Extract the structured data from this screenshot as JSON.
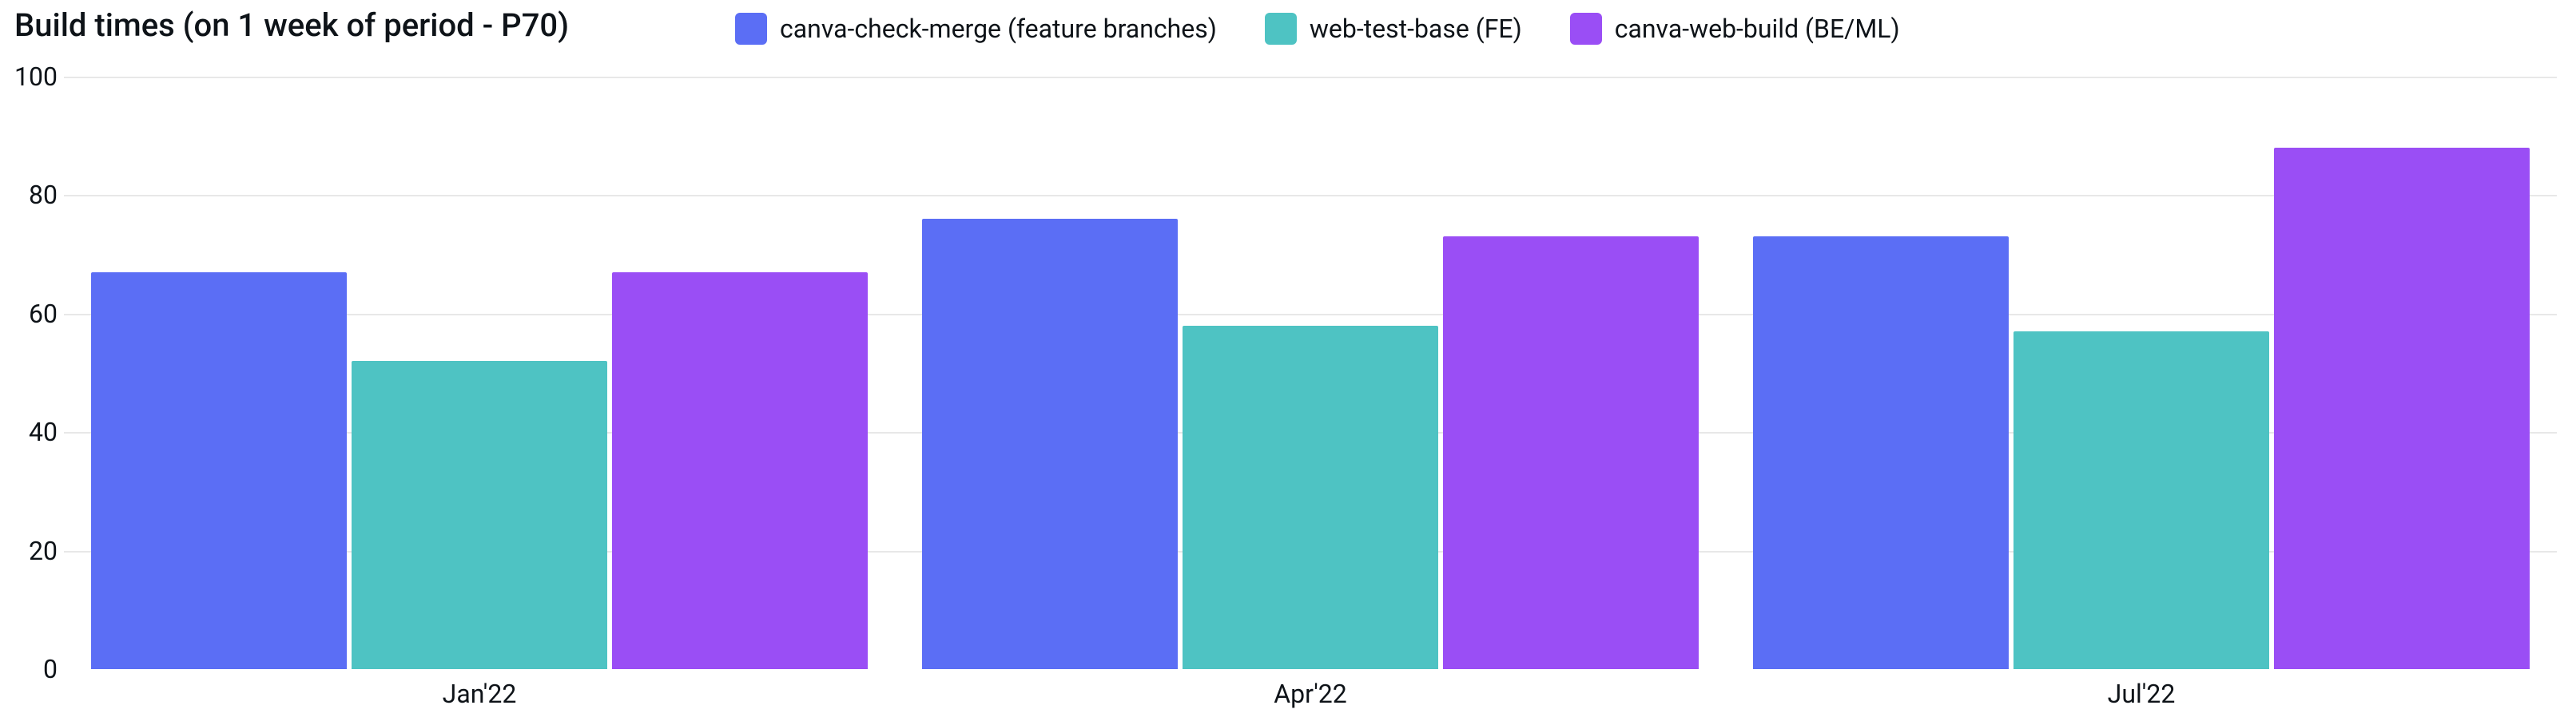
{
  "chart_data": {
    "type": "bar",
    "title": "Build times (on 1 week of period - P70)",
    "categories": [
      "Jan'22",
      "Apr'22",
      "Jul'22"
    ],
    "series": [
      {
        "name": "canva-check-merge (feature branches)",
        "color": "#5b6ef5",
        "values": [
          67,
          76,
          73
        ]
      },
      {
        "name": "web-test-base (FE)",
        "color": "#4ec3c3",
        "values": [
          52,
          58,
          57
        ]
      },
      {
        "name": "canva-web-build (BE/ML)",
        "color": "#9a4ef5",
        "values": [
          67,
          73,
          88
        ]
      }
    ],
    "ylim": [
      0,
      100
    ],
    "yticks": [
      0,
      20,
      40,
      60,
      80,
      100
    ],
    "xlabel": "",
    "ylabel": ""
  }
}
